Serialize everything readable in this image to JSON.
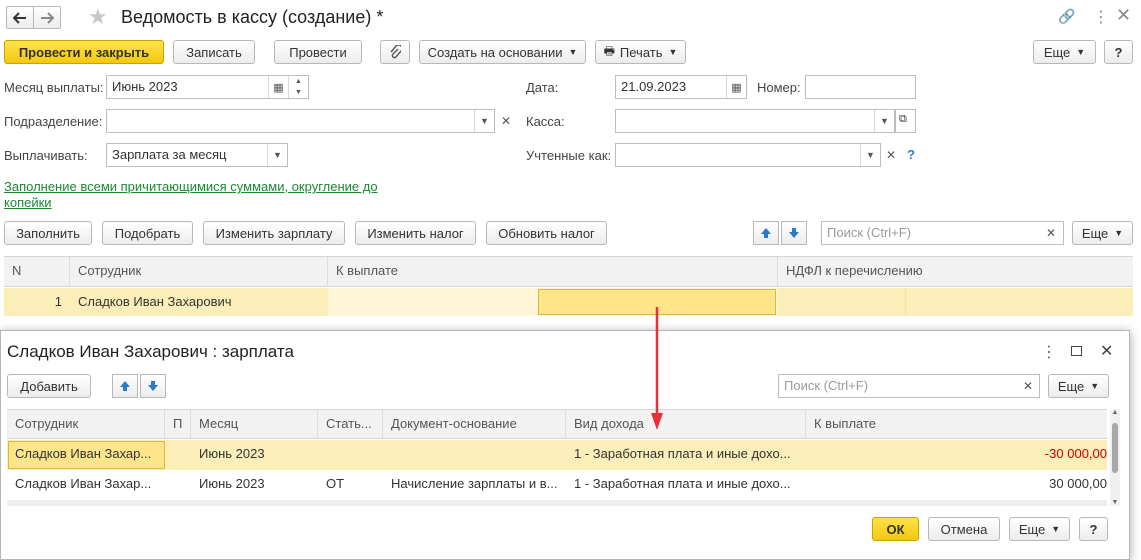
{
  "window": {
    "title": "Ведомость в кассу (создание) *",
    "back_icon": "arrow-left-icon",
    "forward_icon": "arrow-right-icon",
    "favorite_icon": "star-icon"
  },
  "toolbar": {
    "post_close": "Провести и закрыть",
    "save": "Записать",
    "post": "Провести",
    "create_based": "Создать на основании",
    "print": "Печать",
    "more": "Еще",
    "help": "?"
  },
  "form": {
    "month_label": "Месяц выплаты:",
    "month_value": "Июнь 2023",
    "date_label": "Дата:",
    "date_value": "21.09.2023",
    "number_label": "Номер:",
    "number_value": "",
    "dept_label": "Подразделение:",
    "dept_value": "",
    "cash_label": "Касса:",
    "cash_value": "",
    "pay_label": "Выплачивать:",
    "pay_value": "Зарплата за месяц",
    "accounted_label": "Учтенные как:",
    "accounted_value": "",
    "fill_link": "Заполнение всеми причитающимися суммами, округление до копейки"
  },
  "table_toolbar": {
    "fill": "Заполнить",
    "pick": "Подобрать",
    "change_salary": "Изменить зарплату",
    "change_tax": "Изменить налог",
    "update_tax": "Обновить налог",
    "search_placeholder": "Поиск (Ctrl+F)",
    "more": "Еще"
  },
  "main_table": {
    "columns": [
      "N",
      "Сотрудник",
      "К выплате",
      "НДФЛ к перечислению"
    ],
    "rows": [
      {
        "n": "1",
        "employee": "Сладков Иван Захарович",
        "amount": "",
        "tax": ""
      }
    ]
  },
  "dialog": {
    "title": "Сладков Иван Захарович : зарплата",
    "add": "Добавить",
    "search_placeholder": "Поиск (Ctrl+F)",
    "more": "Еще",
    "columns": [
      "Сотрудник",
      "П",
      "Месяц",
      "Стать...",
      "Документ-основание",
      "Вид дохода",
      "К выплате"
    ],
    "rows": [
      {
        "employee": "Сладков Иван Захар...",
        "p": "",
        "month": "Июнь 2023",
        "article": "",
        "doc": "",
        "income": "1 - Заработная плата и иные дохо...",
        "amount": "-30 000,00"
      },
      {
        "employee": "Сладков Иван Захар...",
        "p": "",
        "month": "Июнь 2023",
        "article": "ОТ",
        "doc": "Начисление зарплаты и в...",
        "income": "1 - Заработная плата и иные дохо...",
        "amount": "30 000,00"
      }
    ],
    "ok": "ОК",
    "cancel": "Отмена",
    "more2": "Еще",
    "help": "?",
    "negative_color": "#d00000"
  }
}
